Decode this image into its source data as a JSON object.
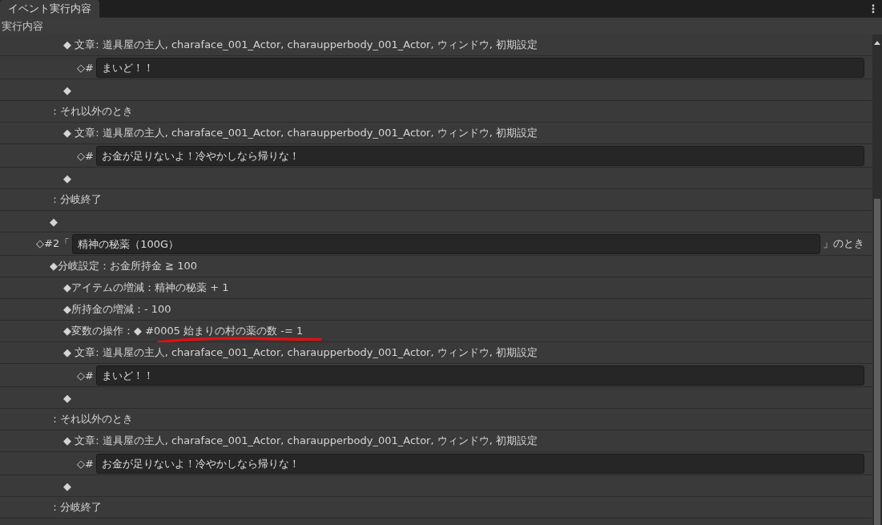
{
  "tab": {
    "label": "イベント実行内容",
    "selected": true
  },
  "section_label": "実行内容",
  "rows": [
    {
      "kind": "group",
      "children": [
        {
          "kind": "group",
          "children": [
            {
              "kind": "line",
              "text": "◆ 文章: 道具屋の主人, charaface_001_Actor, charaupperbody_001_Actor, ウィンドウ, 初期設定",
              "children": [
                {
                  "kind": "input",
                  "prefix": "◇#",
                  "value": "まいど！！"
                }
              ]
            },
            {
              "kind": "line",
              "text": "◆"
            }
          ]
        },
        {
          "kind": "line",
          "text": "：それ以外のとき",
          "children": [
            {
              "kind": "line",
              "text": "◆ 文章: 道具屋の主人, charaface_001_Actor, charaupperbody_001_Actor, ウィンドウ, 初期設定",
              "children": [
                {
                  "kind": "input",
                  "prefix": "◇#",
                  "value": "お金が足りないよ！冷やかしなら帰りな！"
                }
              ]
            },
            {
              "kind": "line",
              "text": "◆"
            }
          ]
        },
        {
          "kind": "line",
          "text": "：分岐終了"
        },
        {
          "kind": "line",
          "text": "◆"
        }
      ]
    },
    {
      "kind": "input",
      "prefix": "◇#2「",
      "value": "精神の秘薬（100G）",
      "suffix": "」のとき",
      "children": [
        {
          "kind": "line",
          "text": "◆分岐設定：お金所持金 ≧ 100",
          "children": [
            {
              "kind": "line",
              "text": "◆アイテムの増減：精神の秘薬 + 1"
            },
            {
              "kind": "line",
              "text": "◆所持金の増減：- 100"
            },
            {
              "kind": "line",
              "text": "◆変数の操作：◆ #0005 始まりの村の薬の数 -= 1",
              "annotated": true
            },
            {
              "kind": "line",
              "text": "◆ 文章: 道具屋の主人, charaface_001_Actor, charaupperbody_001_Actor, ウィンドウ, 初期設定",
              "children": [
                {
                  "kind": "input",
                  "prefix": "◇#",
                  "value": "まいど！！"
                }
              ]
            },
            {
              "kind": "line",
              "text": "◆"
            }
          ]
        },
        {
          "kind": "line",
          "text": "：それ以外のとき",
          "children": [
            {
              "kind": "line",
              "text": "◆ 文章: 道具屋の主人, charaface_001_Actor, charaupperbody_001_Actor, ウィンドウ, 初期設定",
              "children": [
                {
                  "kind": "input",
                  "prefix": "◇#",
                  "value": "お金が足りないよ！冷やかしなら帰りな！"
                }
              ]
            },
            {
              "kind": "line",
              "text": "◆"
            }
          ]
        },
        {
          "kind": "line",
          "text": "：分岐終了"
        }
      ]
    }
  ]
}
